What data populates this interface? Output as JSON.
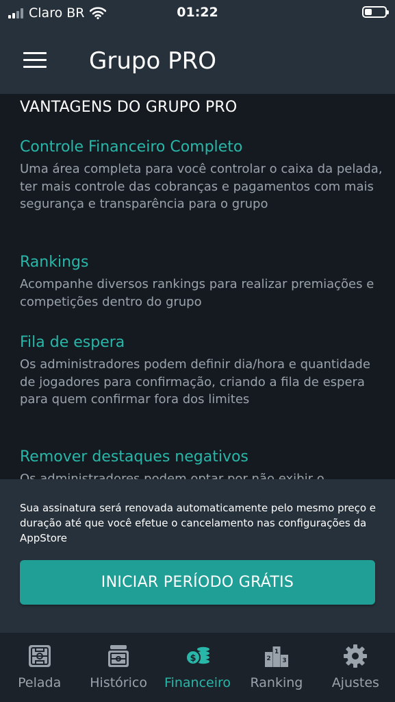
{
  "status_bar": {
    "carrier": "Claro BR",
    "time": "01:22"
  },
  "nav": {
    "title": "Grupo PRO"
  },
  "content": {
    "section_title": "VANTAGENS DO GRUPO PRO",
    "features": [
      {
        "title": "Controle Financeiro Completo",
        "description": "Uma área completa para você controlar o caixa da pelada, ter mais controle das cobranças e pagamentos com mais segurança e transparência para o grupo"
      },
      {
        "title": "Rankings",
        "description": "Acompanhe diversos rankings para realizar premiações e competições dentro do grupo"
      },
      {
        "title": "Fila de espera",
        "description": "Os administradores podem definir dia/hora e quantidade de jogadores para confirmação, criando a fila de espera para quem confirmar fora dos limites"
      },
      {
        "title": "Remover destaques negativos",
        "description": "Os administradores podem optar por não exibir o"
      }
    ]
  },
  "footer": {
    "notice": "Sua assinatura será renovada automaticamente pelo mesmo preço e duração até que você efetue o cancelamento nas configurações da AppStore",
    "cta_label": "INICIAR PERÍODO GRÁTIS"
  },
  "tabbar": {
    "tabs": [
      {
        "label": "Pelada",
        "icon": "field-icon",
        "active": false
      },
      {
        "label": "Histórico",
        "icon": "history-icon",
        "active": false
      },
      {
        "label": "Financeiro",
        "icon": "money-icon",
        "active": true
      },
      {
        "label": "Ranking",
        "icon": "podium-icon",
        "active": false
      },
      {
        "label": "Ajustes",
        "icon": "gear-icon",
        "active": false
      }
    ]
  },
  "colors": {
    "accent": "#28b7a8",
    "header_bg": "#27313b",
    "content_bg": "#141a20",
    "cta_bg": "#1f9f95"
  }
}
